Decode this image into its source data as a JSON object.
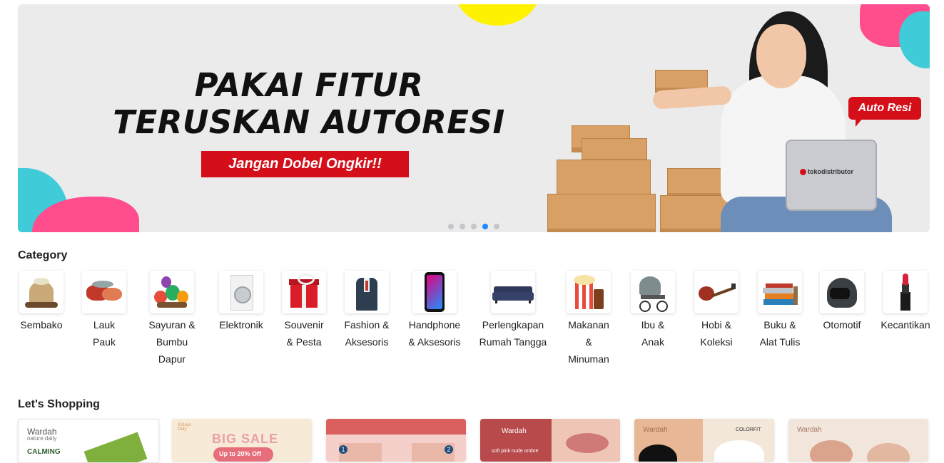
{
  "banner": {
    "headline_line1": "PAKAI FITUR",
    "headline_line2": "TERUSKAN AUTORESI",
    "subheadline": "Jangan Dobel Ongkir!!",
    "tag": "Auto Resi",
    "laptop_brand": "tokodistributor",
    "slides_total": 5,
    "active_slide_index": 3
  },
  "category": {
    "title": "Category",
    "items": [
      {
        "label": "Sembako",
        "icon": "rice-sack-icon"
      },
      {
        "label": "Lauk Pauk",
        "icon": "meat-fish-icon"
      },
      {
        "label": "Sayuran & Bumbu Dapur",
        "icon": "vegetables-icon"
      },
      {
        "label": "Elektronik",
        "icon": "washing-machine-icon"
      },
      {
        "label": "Souvenir & Pesta",
        "icon": "gift-box-icon"
      },
      {
        "label": "Fashion & Aksesoris",
        "icon": "suit-icon"
      },
      {
        "label": "Handphone & Aksesoris",
        "icon": "smartphone-icon"
      },
      {
        "label": "Perlengkapan Rumah Tangga",
        "icon": "sofa-icon"
      },
      {
        "label": "Makanan & Minuman",
        "icon": "popcorn-icon"
      },
      {
        "label": "Ibu & Anak",
        "icon": "stroller-icon"
      },
      {
        "label": "Hobi & Koleksi",
        "icon": "guitar-icon"
      },
      {
        "label": "Buku & Alat Tulis",
        "icon": "books-icon"
      },
      {
        "label": "Otomotif",
        "icon": "helmet-icon"
      },
      {
        "label": "Kecantikan",
        "icon": "lipstick-icon"
      }
    ]
  },
  "shopping": {
    "title": "Let's Shopping",
    "cards": [
      {
        "brand": "Wardah",
        "sub": "nature daily",
        "text": "CALMING"
      },
      {
        "brand": "",
        "sub": "3 Days Only",
        "text": "BIG SALE",
        "extra": "Up to 20% Off"
      },
      {
        "brand": "",
        "sub": "",
        "text": "1",
        "extra": "2"
      },
      {
        "brand": "Wardah",
        "sub": "",
        "text": "soft pink nude ombre"
      },
      {
        "brand": "Wardah",
        "sub": "COLORFIT",
        "text": ""
      },
      {
        "brand": "Wardah",
        "sub": "",
        "text": ""
      }
    ]
  },
  "colors": {
    "brand_red": "#d50f1a",
    "active_dot": "#1a8cff",
    "inactive_dot": "#c4c6c9"
  }
}
